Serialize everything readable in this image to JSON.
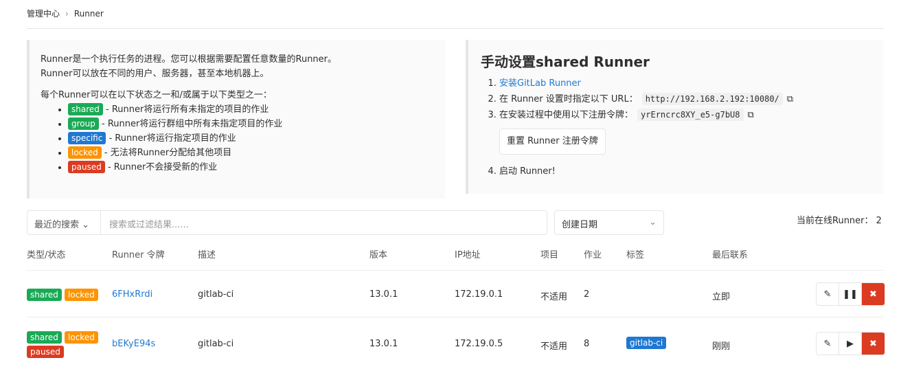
{
  "breadcrumb": [
    "管理中心",
    "Runner"
  ],
  "info": {
    "line1": "Runner是一个执行任务的进程。您可以根据需要配置任意数量的Runner。",
    "line2": "Runner可以放在不同的用户、服务器，甚至本地机器上。",
    "line3": "每个Runner可以在以下状态之一和/或属于以下类型之一：",
    "items": [
      {
        "badge": "shared",
        "text": " - Runner将运行所有未指定的项目的作业"
      },
      {
        "badge": "group",
        "text": " - Runner将运行群组中所有未指定项目的作业"
      },
      {
        "badge": "specific",
        "text": " - Runner将运行指定项目的作业"
      },
      {
        "badge": "locked",
        "text": " - 无法将Runner分配给其他项目"
      },
      {
        "badge": "paused",
        "text": " - Runner不会接受新的作业"
      }
    ]
  },
  "manual": {
    "title": "手动设置shared Runner",
    "step1": "安装GitLab Runner",
    "step2": "在 Runner 设置时指定以下 URL：",
    "url": "http://192.168.2.192:10080/",
    "step3": "在安装过程中使用以下注册令牌：",
    "token": "yrErncrc8XY_e5-g7bU8",
    "reset": "重置 Runner 注册令牌",
    "step4": "启动 Runner!"
  },
  "filter": {
    "recent": "最近的搜索",
    "placeholder": "搜索或过滤结果......",
    "sort": "创建日期"
  },
  "online": "当前在线Runner： 2",
  "headers": [
    "类型/状态",
    "Runner 令牌",
    "描述",
    "版本",
    "IP地址",
    "项目",
    "作业",
    "标签",
    "最后联系"
  ],
  "rows": [
    {
      "badges": [
        "shared",
        "locked"
      ],
      "token": "6FHxRrdi",
      "desc": "gitlab-ci",
      "version": "13.0.1",
      "ip": "172.19.0.1",
      "project": "不适用",
      "jobs": "2",
      "tag": "",
      "last": "立即"
    },
    {
      "badges": [
        "shared",
        "locked",
        "paused"
      ],
      "token": "bEKyE94s",
      "desc": "gitlab-ci",
      "version": "13.0.1",
      "ip": "172.19.0.5",
      "project": "不适用",
      "jobs": "8",
      "tag": "gitlab-ci",
      "last": "刚刚"
    }
  ]
}
